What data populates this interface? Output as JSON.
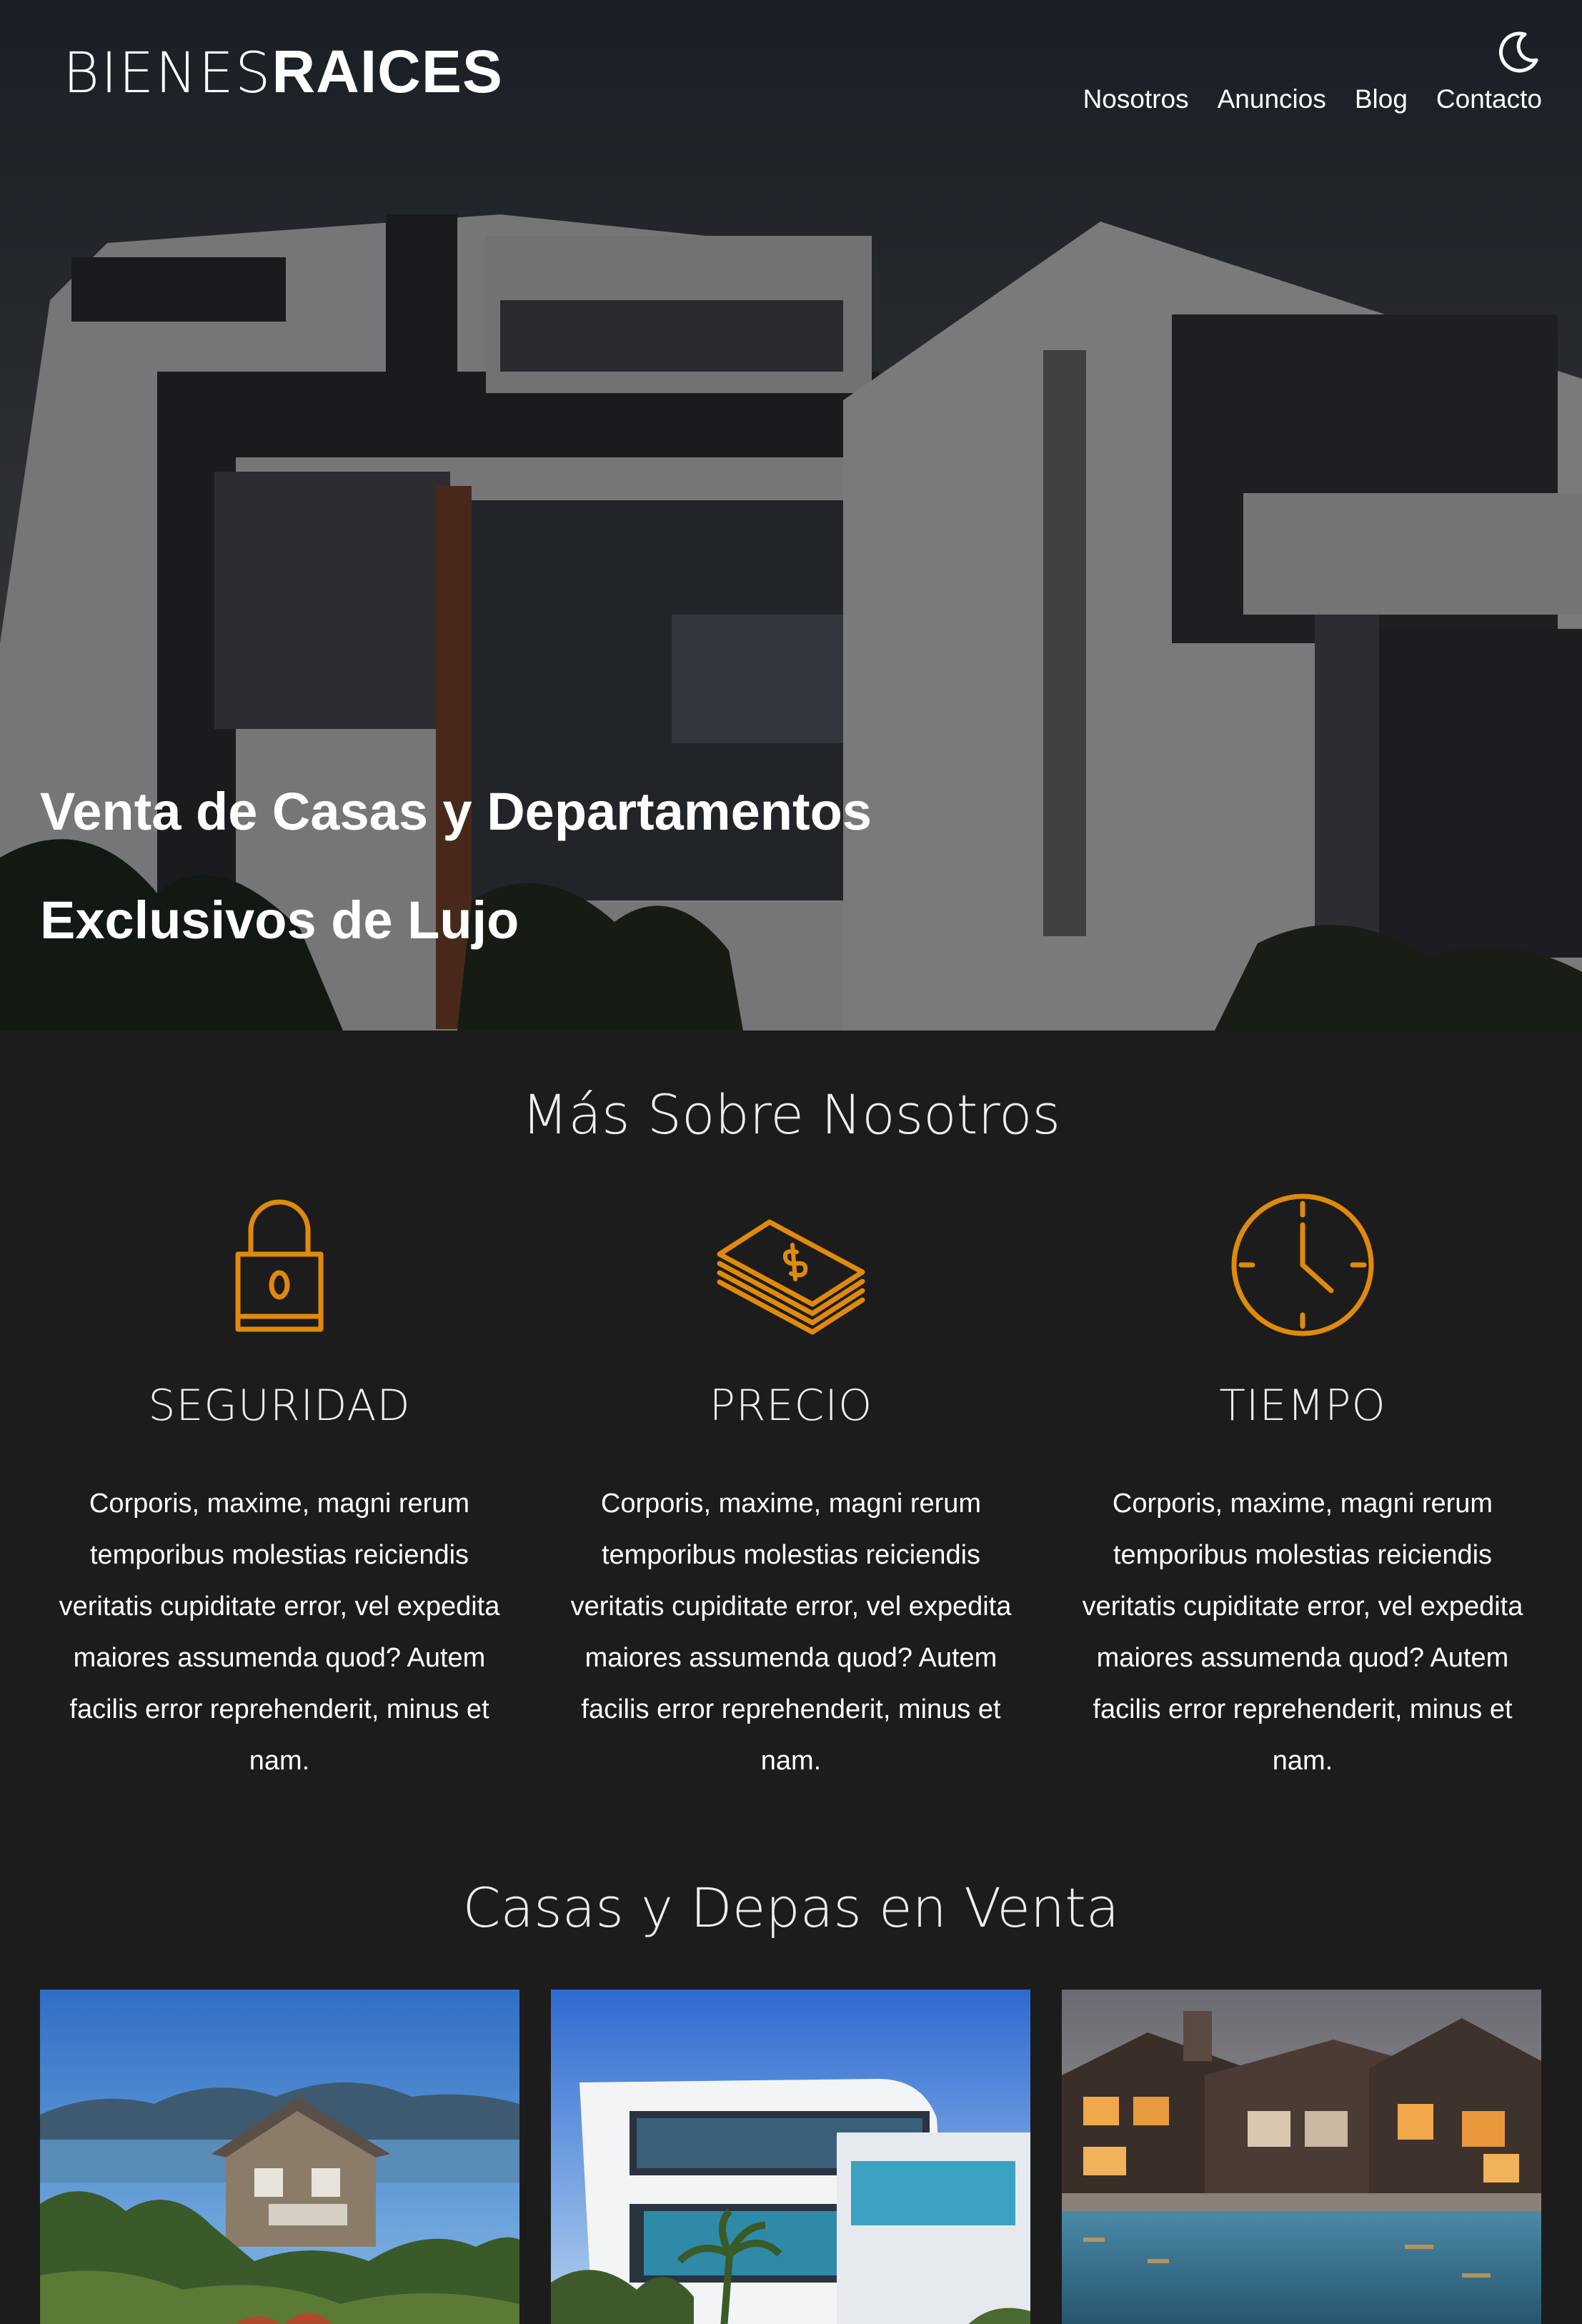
{
  "header": {
    "logo_light": "BIENES",
    "logo_bold": "RAICES",
    "nav": [
      "Nosotros",
      "Anuncios",
      "Blog",
      "Contacto"
    ],
    "dark_mode_icon": "moon-icon"
  },
  "hero": {
    "title_line1": "Venta de Casas y Departamentos",
    "title_line2": "Exclusivos de Lujo"
  },
  "about": {
    "title": "Más Sobre Nosotros",
    "features": [
      {
        "icon": "lock-icon",
        "title": "SEGURIDAD",
        "text": "Corporis, maxime, magni rerum temporibus molestias reiciendis veritatis cupiditate error, vel expedita maiores assumenda quod? Autem facilis error reprehenderit, minus et nam."
      },
      {
        "icon": "money-stack-icon",
        "title": "PRECIO",
        "text": "Corporis, maxime, magni rerum temporibus molestias reiciendis veritatis cupiditate error, vel expedita maiores assumenda quod? Autem facilis error reprehenderit, minus et nam."
      },
      {
        "icon": "clock-icon",
        "title": "TIEMPO",
        "text": "Corporis, maxime, magni rerum temporibus molestias reiciendis veritatis cupiditate error, vel expedita maiores assumenda quod? Autem facilis error reprehenderit, minus et nam."
      }
    ],
    "accent_color": "#e08a0b"
  },
  "listings": {
    "title": "Casas y Depas en Venta",
    "cards": [
      {
        "image": "lake-house-photo"
      },
      {
        "image": "modern-white-house-photo"
      },
      {
        "image": "pool-mansion-photo"
      }
    ]
  }
}
